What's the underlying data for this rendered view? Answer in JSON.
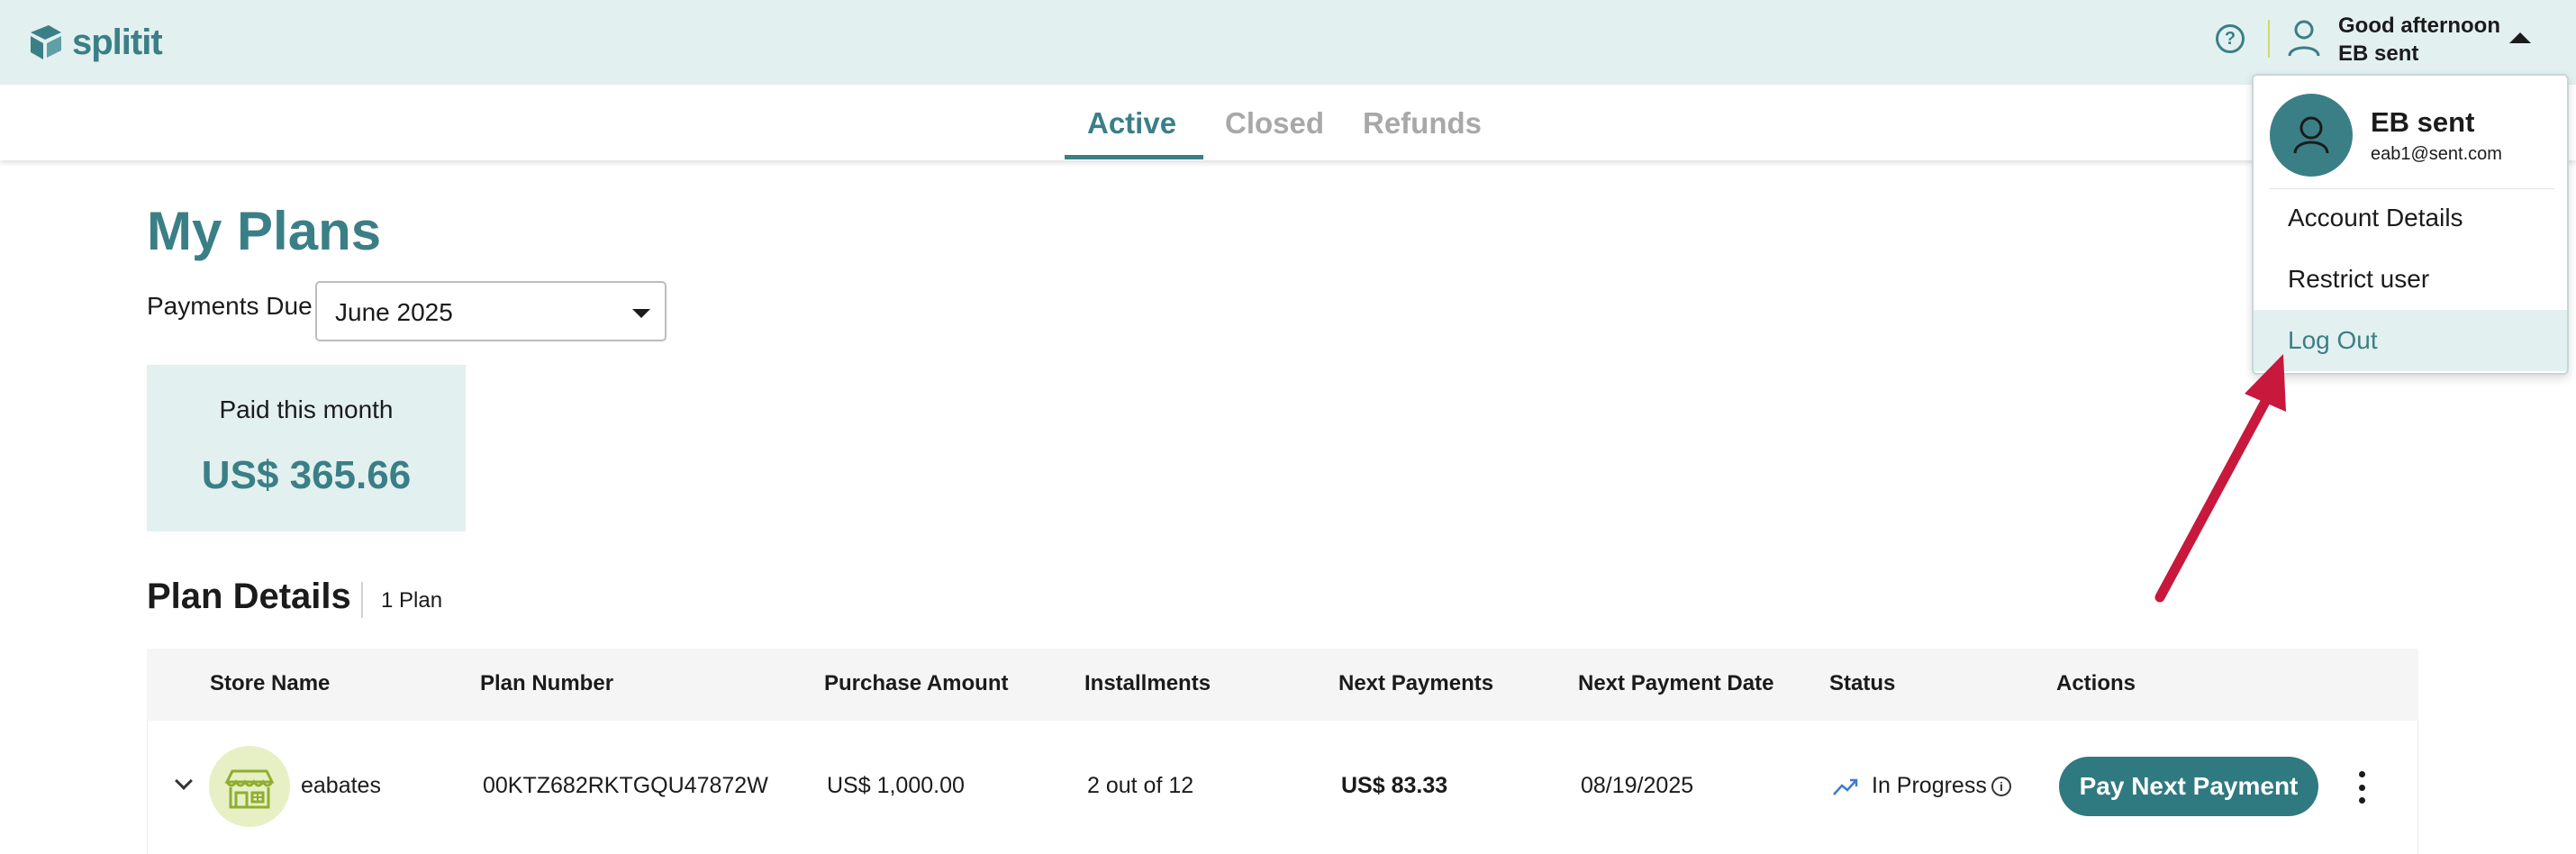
{
  "header": {
    "logo_text": "splitit",
    "greeting": "Good afternoon",
    "user_name": "EB sent",
    "help_glyph": "?"
  },
  "tabs": [
    {
      "label": "Active",
      "active": true
    },
    {
      "label": "Closed",
      "active": false
    },
    {
      "label": "Refunds",
      "active": false
    }
  ],
  "page": {
    "title": "My Plans",
    "payments_due_label": "Payments Due",
    "payments_due_value": "June 2025",
    "paid_card": {
      "label": "Paid this month",
      "value": "US$ 365.66"
    },
    "plan_details_title": "Plan Details",
    "plan_count": "1 Plan"
  },
  "table": {
    "columns": [
      "Store Name",
      "Plan Number",
      "Purchase Amount",
      "Installments",
      "Next Payments",
      "Next Payment Date",
      "Status",
      "Actions"
    ],
    "rows": [
      {
        "store_name": "eabates",
        "plan_number": "00KTZ682RKTGQU47872W",
        "purchase_amount": "US$ 1,000.00",
        "installments": "2 out of 12",
        "next_payment": "US$ 83.33",
        "next_payment_date": "08/19/2025",
        "status": "In Progress",
        "action_label": "Pay Next Payment"
      }
    ]
  },
  "user_menu": {
    "name": "EB sent",
    "email": "eab1@sent.com",
    "items": [
      {
        "label": "Account Details"
      },
      {
        "label": "Restrict user"
      },
      {
        "label": "Log Out"
      }
    ]
  },
  "colors": {
    "brand": "#3b7f86",
    "header_bg": "#e3f0f0",
    "button": "#2f7a80",
    "annotation_arrow": "#c8183c"
  },
  "icons": [
    "splitit-logo-icon",
    "help-icon",
    "user-icon",
    "caret-up-icon",
    "caret-down-icon",
    "chevron-down-icon",
    "store-icon",
    "trending-up-icon",
    "info-icon",
    "kebab-menu-icon",
    "avatar-icon"
  ]
}
